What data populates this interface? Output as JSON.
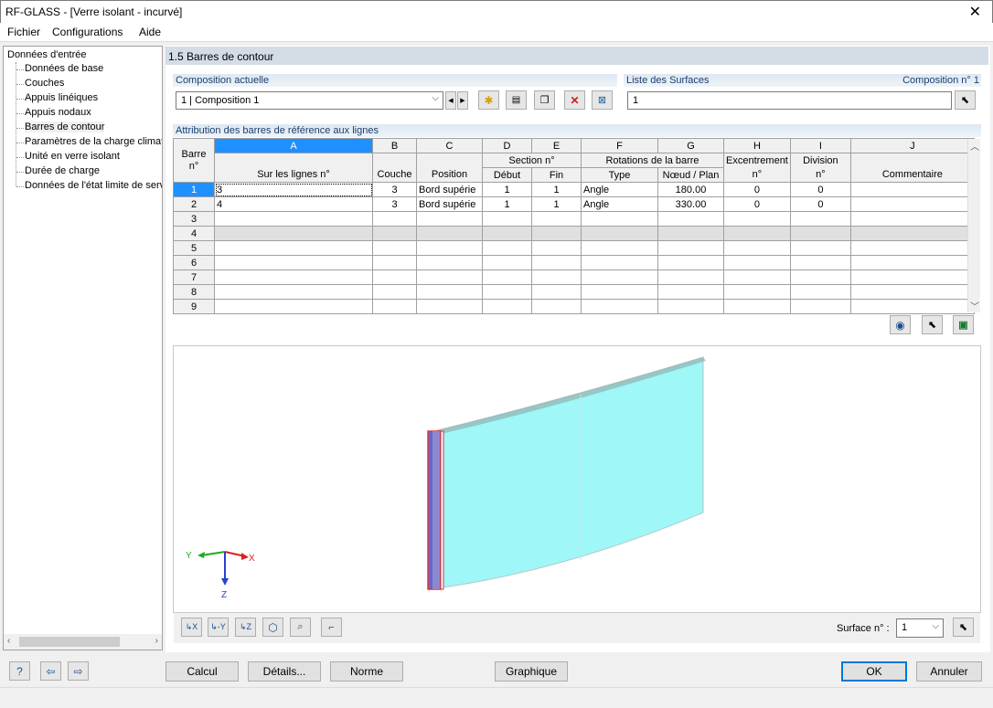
{
  "window": {
    "title": "RF-GLASS - [Verre isolant - incurvé]"
  },
  "menu": [
    "Fichier",
    "Configurations",
    "Aide"
  ],
  "tree": {
    "root": "Données d'entrée",
    "items": [
      "Données de base",
      "Couches",
      "Appuis linéiques",
      "Appuis nodaux",
      "Barres de contour",
      "Paramètres de la charge climati",
      "Unité en verre isolant",
      "Durée de charge",
      "Données de l'état limite de serv"
    ],
    "selected_index": 4
  },
  "section_title": "1.5 Barres de contour",
  "composition": {
    "label": "Composition actuelle",
    "value": "1 | Composition 1"
  },
  "surfaces": {
    "label": "Liste des Surfaces",
    "composition_label": "Composition n° 1",
    "value": "1"
  },
  "grid": {
    "group_label": "Attribution des barres de référence aux lignes",
    "col_letters": [
      "A",
      "B",
      "C",
      "D",
      "E",
      "F",
      "G",
      "H",
      "I",
      "J"
    ],
    "row_header_top": "Barre",
    "row_header_bottom": "n°",
    "header_top": {
      "section": "Section n°",
      "rotations": "Rotations de la barre",
      "excentrement": "Excentrement",
      "division": "Division"
    },
    "header_bottom": [
      "Sur les lignes n°",
      "Couche",
      "Position",
      "Début",
      "Fin",
      "Type",
      "Nœud / Plan",
      "n°",
      "n°",
      "Commentaire"
    ],
    "rows": [
      {
        "n": "1",
        "cells": [
          "3",
          "3",
          "Bord supérie",
          "1",
          "1",
          "Angle",
          "180.00",
          "0",
          "0",
          ""
        ]
      },
      {
        "n": "2",
        "cells": [
          "4",
          "3",
          "Bord supérie",
          "1",
          "1",
          "Angle",
          "330.00",
          "0",
          "0",
          ""
        ]
      },
      {
        "n": "3",
        "cells": [
          "",
          "",
          "",
          "",
          "",
          "",
          "",
          "",
          "",
          ""
        ]
      },
      {
        "n": "4",
        "cells": [
          "",
          "",
          "",
          "",
          "",
          "",
          "",
          "",
          "",
          ""
        ]
      },
      {
        "n": "5",
        "cells": [
          "",
          "",
          "",
          "",
          "",
          "",
          "",
          "",
          "",
          ""
        ]
      },
      {
        "n": "6",
        "cells": [
          "",
          "",
          "",
          "",
          "",
          "",
          "",
          "",
          "",
          ""
        ]
      },
      {
        "n": "7",
        "cells": [
          "",
          "",
          "",
          "",
          "",
          "",
          "",
          "",
          "",
          ""
        ]
      },
      {
        "n": "8",
        "cells": [
          "",
          "",
          "",
          "",
          "",
          "",
          "",
          "",
          "",
          ""
        ]
      },
      {
        "n": "9",
        "cells": [
          "",
          "",
          "",
          "",
          "",
          "",
          "",
          "",
          "",
          ""
        ]
      }
    ]
  },
  "axes": {
    "x": "X",
    "y": "Y",
    "z": "Z"
  },
  "graphics": {
    "surface_label": "Surface n° :",
    "surface_value": "1"
  },
  "buttons": {
    "calcul": "Calcul",
    "details": "Détails...",
    "norme": "Norme",
    "graphique": "Graphique",
    "ok": "OK",
    "annuler": "Annuler"
  },
  "colors": {
    "glass": "#9ff7f7",
    "selection": "#1e90ff",
    "header": "#d4dde6",
    "edge": "#e0303a"
  }
}
